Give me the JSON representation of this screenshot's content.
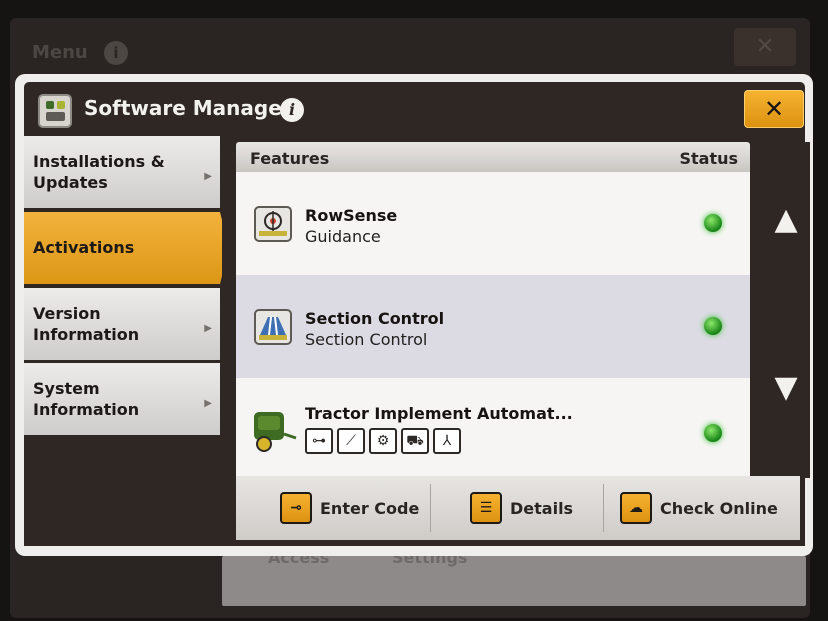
{
  "background": {
    "menu_title": "Menu",
    "bottom_labels": [
      "Access",
      "Settings"
    ]
  },
  "dialog": {
    "title": "Software Manager",
    "close_glyph": "✕",
    "info_glyph": "i"
  },
  "sidebar": {
    "items": [
      {
        "label": "Installations & Updates",
        "active": false
      },
      {
        "label": "Activations",
        "active": true
      },
      {
        "label": "Version Information",
        "active": false
      },
      {
        "label": "System Information",
        "active": false
      }
    ]
  },
  "table": {
    "col_features": "Features",
    "col_status": "Status",
    "rows": [
      {
        "name": "RowSense",
        "desc": "Guidance",
        "icon": "rowsense-icon",
        "status_color": "#2ec02a"
      },
      {
        "name": "Section Control",
        "desc": "Section Control",
        "icon": "section-control-icon",
        "status_color": "#2ec02a"
      },
      {
        "name": "Tractor Implement Automat...",
        "desc": "",
        "icon": "baler-icon",
        "status_color": "#2ec02a"
      }
    ]
  },
  "scroll": {
    "up_glyph": "▲",
    "down_glyph": "▼"
  },
  "footer": {
    "enter_code": "Enter Code",
    "details": "Details",
    "check_online": "Check Online"
  },
  "colors": {
    "accent": "#e9a324",
    "titlebar": "#2e2724",
    "status_green": "#2ec02a"
  }
}
